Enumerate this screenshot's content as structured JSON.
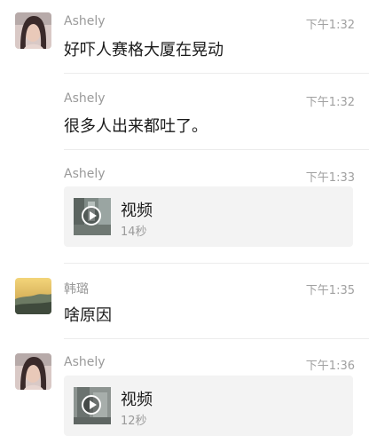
{
  "messages": [
    {
      "sender": "Ashely",
      "time": "下午1:32",
      "text": "好吓人赛格大厦在晃动"
    },
    {
      "sender": "Ashely",
      "time": "下午1:32",
      "text": "很多人出来都吐了。"
    },
    {
      "sender": "Ashely",
      "time": "下午1:33",
      "video": {
        "label": "视频",
        "duration": "14秒"
      }
    },
    {
      "sender": "韩璐",
      "time": "下午1:35",
      "text": "啥原因"
    },
    {
      "sender": "Ashely",
      "time": "下午1:36",
      "video": {
        "label": "视频",
        "duration": "12秒"
      }
    }
  ],
  "icons": {
    "avatar_ashely": "avatar-icon",
    "avatar_hanlu": "avatar-icon",
    "play": "play-icon"
  }
}
